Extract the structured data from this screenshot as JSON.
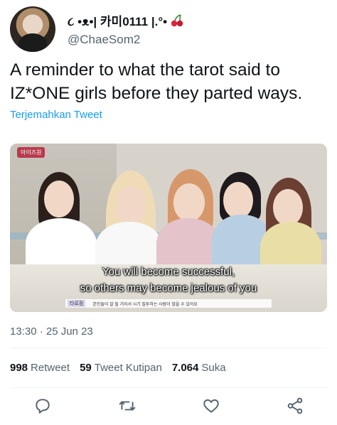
{
  "author": {
    "display_name": "૮ •ᴥ•| 카미0111 |.°•",
    "handle": "@ChaeSom2",
    "emoji_icon": "cherry-icon"
  },
  "tweet": {
    "text": "A reminder to what the tarot said to IZ*ONE girls before they parted ways.",
    "translate_label": "Terjemahkan Tweet",
    "timestamp": "13:30 · 25 Jun 23"
  },
  "media": {
    "show_logo": "아이즈원",
    "subtitle_line1": "You will become successful,",
    "subtitle_line2": "so others may become jealous of you",
    "bar_tag": "타로점",
    "bar_text": "본인들이 잘 될 거라서 시기 질투하는 사람이 많을 수 있어요"
  },
  "stats": {
    "retweets_value": "998",
    "retweets_label": "Retweet",
    "quotes_value": "59",
    "quotes_label": "Tweet Kutipan",
    "likes_value": "7.064",
    "likes_label": "Suka"
  },
  "colors": {
    "accent": "#1d9bf0",
    "secondary_text": "#536471",
    "primary_text": "#0f1419"
  }
}
